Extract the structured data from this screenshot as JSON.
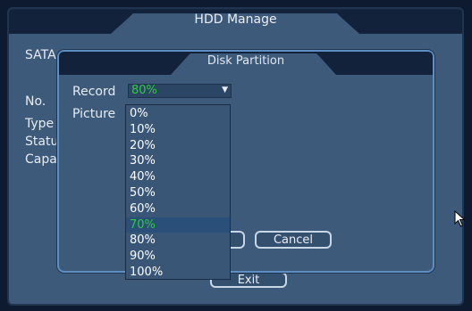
{
  "hdd_manage": {
    "title": "HDD Manage",
    "sata_label": "SATA",
    "info_labels": [
      "No.",
      "Type",
      "Statu",
      "Capa"
    ],
    "exit_label": "Exit"
  },
  "disk_partition": {
    "title": "Disk Partition",
    "record_label": "Record",
    "record_value": "80%",
    "picture_label": "Picture",
    "cancel_label": "Cancel",
    "dropdown_options": [
      "0%",
      "10%",
      "20%",
      "30%",
      "40%",
      "50%",
      "60%",
      "70%",
      "80%",
      "90%",
      "100%"
    ],
    "highlighted_option": "70%"
  },
  "colors": {
    "selected_text": "#2ecc3a",
    "window_bg": "#3e5a7a",
    "title_bar": "#12223a"
  }
}
